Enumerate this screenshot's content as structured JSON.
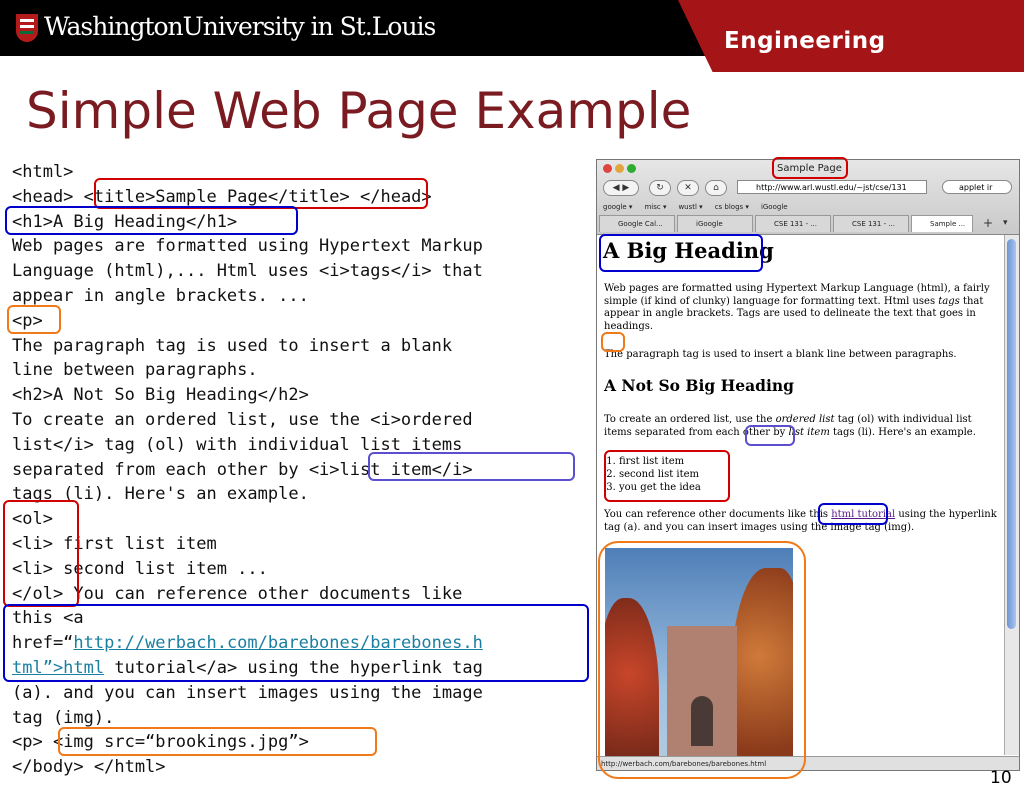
{
  "header": {
    "university": "WashingtonUniversity in St.Louis",
    "school": "Engineering"
  },
  "slide": {
    "title": "Simple Web Page Example",
    "page_number": "10"
  },
  "code": {
    "l1": "<html>",
    "l2a": "<head> ",
    "l2b": "<title>Sample Page</title>",
    "l2c": " </head>",
    "l3": "<h1>A Big Heading</h1>",
    "l4": "Web pages are formatted using Hypertext Markup",
    "l5": "Language (html),... Html uses <i>tags</i> that",
    "l6": "appear in angle brackets. ...",
    "l7": "<p>",
    "l8": "The paragraph tag is used to insert a blank",
    "l9": "line between paragraphs.",
    "l10": "<h2>A Not So Big Heading</h2>",
    "l11": "To create an ordered list, use the <i>ordered",
    "l12": "list</i> tag (ol) with individual list items",
    "l13a": "separated from each other by ",
    "l13b": "<i>list item</i>",
    "l14": "tags (li). Here's an example.",
    "l15": "<ol>",
    "l16": "<li> first list item",
    "l17": "<li> second list item ...",
    "l18": "</ol> You can reference other documents like",
    "l19": "this <a",
    "l20a": "href=“",
    "l20b": "http://werbach.com/barebones/barebones.h",
    "l21a": "tml”>html",
    "l21b": " tutorial</a> using the hyperlink tag",
    "l22": "(a). and you can insert images using the image",
    "l23": "tag (img).",
    "l24a": "<p> ",
    "l24b": "<img src=“brookings.jpg”>",
    "l25": "</body> </html>"
  },
  "browser": {
    "window_title": "Sample Page",
    "url": "http://www.arl.wustl.edu/~jst/cse/131",
    "search_text": "applet ir",
    "bookmarks": [
      "google ▾",
      "misc ▾",
      "wustl ▾",
      "cs blogs ▾",
      "iGoogle"
    ],
    "tabs": [
      "Google Cal...",
      "iGoogle",
      "CSE 131 - ...",
      "CSE 131 - ...",
      "Sample ..."
    ],
    "status_url": "http://werbach.com/barebones/barebones.html",
    "page": {
      "h1": "A Big Heading",
      "p1a": "Web pages are formatted using Hypertext Markup Language (html), a fairly simple (if kind of clunky) language for formatting text. Html uses ",
      "p1_em": "tags",
      "p1b": " that appear in angle brackets. Tags are used to delineate the text that goes in headings.",
      "p2": "The paragraph tag is used to insert a blank line between paragraphs.",
      "h2": "A Not So Big Heading",
      "p3a": "To create an ordered list, use the ",
      "p3_em1": "ordered list",
      "p3b": " tag (ol) with individual list items separated from each other by ",
      "p3_em2": "list item",
      "p3c": " tags (li). Here's an example.",
      "list": [
        "first list item",
        "second list item",
        "you get the idea"
      ],
      "p4a": "You can reference other documents like this ",
      "p4_link": "html tutorial",
      "p4b": " using the hyperlink tag (a). and you can insert images using the image tag (img)."
    }
  },
  "colors": {
    "title": "#7a1b22",
    "red_band": "#a51417",
    "link": "#1a7fa0"
  }
}
